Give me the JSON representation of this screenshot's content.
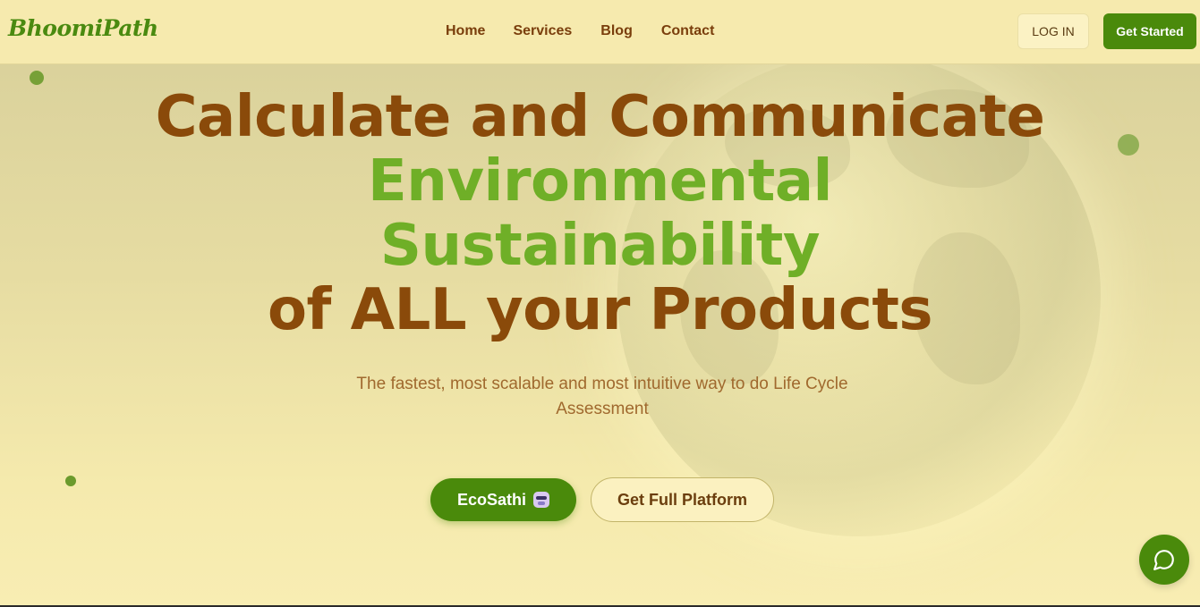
{
  "brand": {
    "logo_text": "BhoomiPath"
  },
  "nav": {
    "links": [
      {
        "label": "Home"
      },
      {
        "label": "Services"
      },
      {
        "label": "Blog"
      },
      {
        "label": "Contact"
      }
    ],
    "login_label": "LOG IN",
    "get_started_label": "Get Started"
  },
  "hero": {
    "headline_line1": "Calculate and Communicate",
    "headline_line2": "Environmental",
    "headline_line3": "Sustainability",
    "headline_line4": "of ALL your Products",
    "subtitle": "The fastest, most scalable and most intuitive way to do Life Cycle Assessment",
    "primary_button_label": "EcoSathi",
    "primary_button_icon": "robot-icon",
    "secondary_button_label": "Get Full Platform"
  },
  "chat": {
    "icon": "chat-bubble-icon"
  },
  "colors": {
    "brand_green": "#4a8a0b",
    "headline_brown": "#8a4a0a",
    "headline_green": "#6faf27",
    "background": "#f6eaae"
  }
}
